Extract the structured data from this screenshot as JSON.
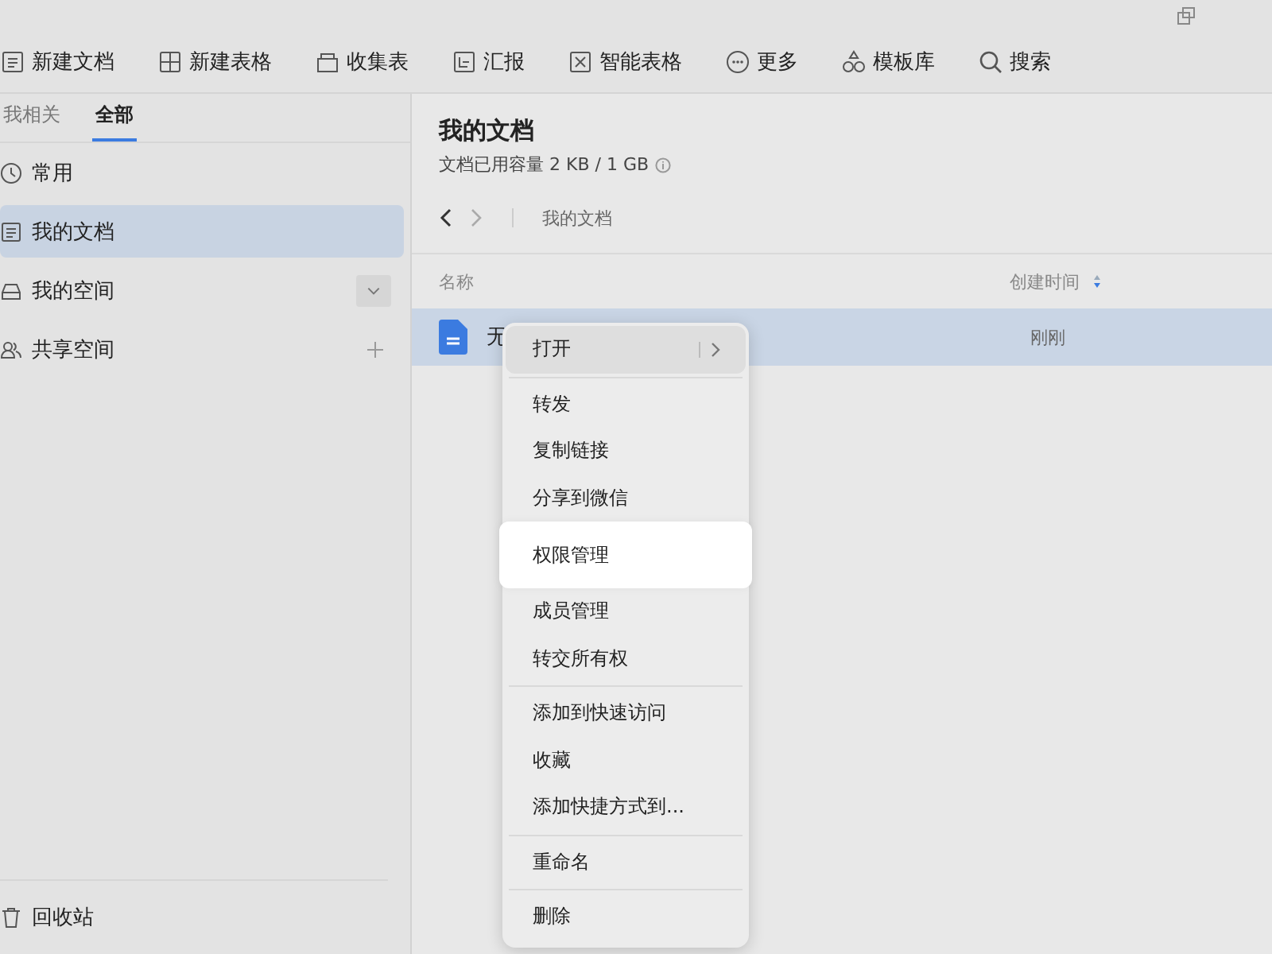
{
  "toolbar": [
    {
      "kind": "doc",
      "label": "新建文档"
    },
    {
      "kind": "grid",
      "label": "新建表格"
    },
    {
      "kind": "box",
      "label": "收集表"
    },
    {
      "kind": "report",
      "label": "汇报"
    },
    {
      "kind": "smart",
      "label": "智能表格"
    },
    {
      "kind": "more",
      "label": "更多"
    },
    {
      "kind": "shapes",
      "label": "模板库"
    },
    {
      "kind": "search",
      "label": "搜索"
    }
  ],
  "sidebar": {
    "tabs": [
      {
        "label": "我相关",
        "selected": false
      },
      {
        "label": "全部",
        "selected": true
      }
    ],
    "items": [
      {
        "kind": "recent",
        "label": "常用",
        "selected": false
      },
      {
        "kind": "docs",
        "label": "我的文档",
        "selected": true
      },
      {
        "kind": "space",
        "label": "我的空间",
        "selected": false
      },
      {
        "kind": "shared",
        "label": "共享空间",
        "selected": false
      }
    ],
    "trash": "回收站"
  },
  "main": {
    "title": "我的文档",
    "storage": "文档已用容量 2 KB / 1 GB",
    "breadcrumb": "我的文档",
    "columns": [
      "名称",
      "创建时间"
    ],
    "rows": [
      {
        "name": "无",
        "created": "刚刚",
        "selected": true
      }
    ]
  },
  "context_menu": [
    [
      {
        "label": "打开",
        "kind": "submenu",
        "selected": false
      }
    ],
    [
      {
        "label": "转发",
        "kind": "plain",
        "selected": false
      },
      {
        "label": "复制链接",
        "kind": "plain",
        "selected": false
      },
      {
        "label": "分享到微信",
        "kind": "plain",
        "selected": false
      },
      {
        "label": "权限管理",
        "kind": "plain",
        "selected": true
      },
      {
        "label": "成员管理",
        "kind": "plain",
        "selected": false
      },
      {
        "label": "转交所有权",
        "kind": "plain",
        "selected": false
      }
    ],
    [
      {
        "label": "添加到快速访问",
        "kind": "plain",
        "selected": false
      },
      {
        "label": "收藏",
        "kind": "plain",
        "selected": false
      },
      {
        "label": "添加快捷方式到...",
        "kind": "plain",
        "selected": false
      }
    ],
    [
      {
        "label": "重命名",
        "kind": "plain",
        "selected": false
      }
    ],
    [
      {
        "label": "删除",
        "kind": "plain",
        "selected": false
      }
    ]
  ]
}
